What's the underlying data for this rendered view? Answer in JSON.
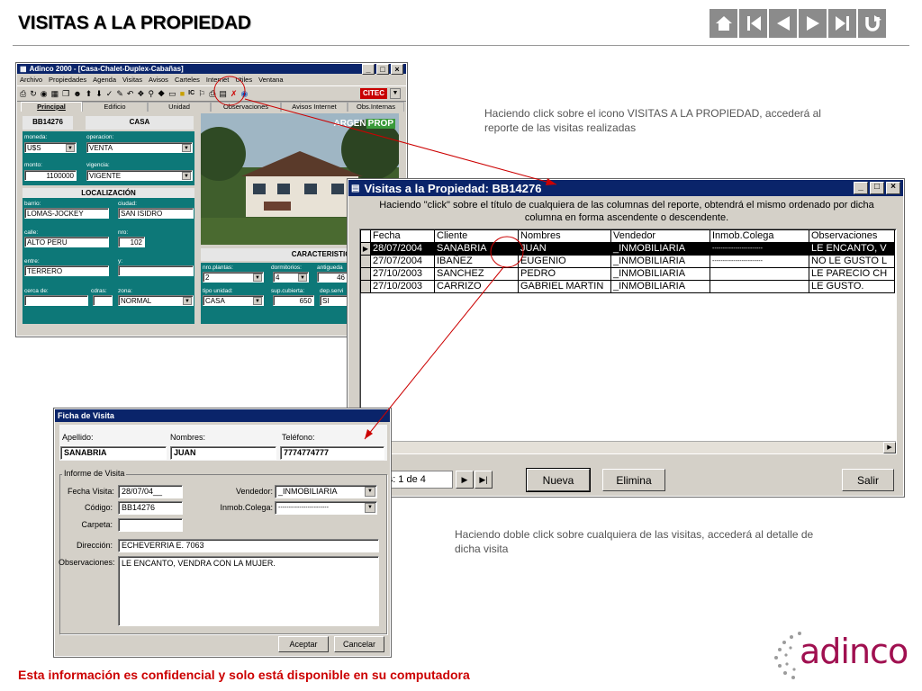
{
  "slide": {
    "title": "VISITAS A LA PROPIEDAD",
    "footer": "Esta información es confidencial y solo está disponible en su computadora",
    "logo_text": "adinco"
  },
  "nav": [
    "home-icon",
    "first-icon",
    "prev-icon",
    "next-icon",
    "last-icon",
    "return-icon"
  ],
  "captions": {
    "top": "Haciendo click sobre el icono VISITAS A LA PROPIEDAD, accederá al reporte de las visitas realizadas",
    "bottom": "Haciendo doble click sobre cualquiera de las visitas, accederá al detalle de dicha visita"
  },
  "main_window": {
    "title": "Adinco 2000 - [Casa-Chalet-Duplex-Cabañas]",
    "menu": [
      "Archivo",
      "Propiedades",
      "Agenda",
      "Visitas",
      "Avisos",
      "Carteles",
      "Internet",
      "Utiles",
      "Ventana"
    ],
    "citec": "CITEC",
    "tabs": [
      "Principal",
      "Edificio",
      "Unidad",
      "Observaciones",
      "Avisos Internet",
      "Obs.Internas"
    ],
    "code": "BB14276",
    "type": "CASA",
    "moneda_label": "moneda:",
    "moneda": "U$S",
    "operacion_label": "operacion:",
    "operacion": "VENTA",
    "monto_label": "monto:",
    "monto": "1100000",
    "vigencia_label": "vigencia:",
    "vigencia": "VIGENTE",
    "localizacion": "LOCALIZACIÓN",
    "barrio_label": "barrio:",
    "barrio": "LOMAS-JOCKEY",
    "ciudad_label": "ciudad:",
    "ciudad": "SAN ISIDRO",
    "calle_label": "calle:",
    "calle": "ALTO PERU",
    "nro_label": "nro:",
    "nro": "102",
    "entre_label": "entre:",
    "entre": "TERRERO",
    "y_label": "y:",
    "cerca_label": "cerca de:",
    "cdras_label": "cdras:",
    "zona_label": "zona:",
    "zona": "NORMAL",
    "photo_brand_a": "ARGEN",
    "photo_brand_b": "PROP",
    "caracteristicas": "CARACTERISTICAS PRINCIPA",
    "plantas_label": "nro.plantas:",
    "plantas": "2",
    "dorm_label": "dormitorios:",
    "dorm": "4",
    "antig_label": "antigueda",
    "antig": "46",
    "tipo_label": "tipo unidad:",
    "tipo": "CASA",
    "supcub_label": "sup.cubierta:",
    "supcub": "650",
    "depserv_label": "dep.servi",
    "depserv": "SI"
  },
  "visits_window": {
    "title": "Visitas a la Propiedad: BB14276",
    "instruction": "Haciendo \"click\" sobre el título de cualquiera de las columnas del reporte, obtendrá el mismo ordenado por dicha columna en forma ascendente o descendente.",
    "columns": [
      "Fecha",
      "Cliente",
      "Nombres",
      "Vendedor",
      "Inmob.Colega",
      "Observaciones"
    ],
    "rows": [
      [
        "28/07/2004",
        "SANABRIA",
        "JUAN",
        "_INMOBILIARIA",
        "------------------------",
        "LE ENCANTO, V"
      ],
      [
        "27/07/2004",
        "IBAÑEZ",
        "EUGENIO",
        "_INMOBILIARIA",
        "------------------------",
        "NO LE GUSTO L"
      ],
      [
        "27/10/2003",
        "SANCHEZ",
        "PEDRO",
        "_INMOBILIARIA",
        "",
        "LE PARECIO CH"
      ],
      [
        "27/10/2003",
        "CARRIZO",
        "GABRIEL MARTIN",
        "_INMOBILIARIA",
        "",
        "LE GUSTO."
      ]
    ],
    "counter": "Visitas: 1 de 4",
    "new_label": "Nueva",
    "delete_label": "Elimina",
    "exit_label": "Salir"
  },
  "visit_form": {
    "title": "Ficha de Visita",
    "apellido_label": "Apellido:",
    "apellido": "SANABRIA",
    "nombres_label": "Nombres:",
    "nombres": "JUAN",
    "telefono_label": "Teléfono:",
    "telefono": "7774774777",
    "group_label": "Informe de Visita",
    "fecha_label": "Fecha Visita:",
    "fecha": "28/07/04__",
    "vendedor_label": "Vendedor:",
    "vendedor": "_INMOBILIARIA",
    "codigo_label": "Código:",
    "codigo": "BB14276",
    "colega_label": "Inmob.Colega:",
    "colega": "------------------------",
    "carpeta_label": "Carpeta:",
    "direccion_label": "Dirección:",
    "direccion": "ECHEVERRIA E. 7063",
    "obs_label": "Observaciones:",
    "obs": "LE ENCANTO, VENDRA CON LA MUJER.",
    "accept_label": "Aceptar",
    "cancel_label": "Cancelar"
  },
  "colors": {
    "titlebar": "#0a246a",
    "teal_panel": "#0d7878",
    "window_bg": "#d4d0c8",
    "annotation": "#cc0000",
    "nav_button": "#8b8b8b",
    "footer": "#cc0000",
    "logo": "#a01050"
  }
}
